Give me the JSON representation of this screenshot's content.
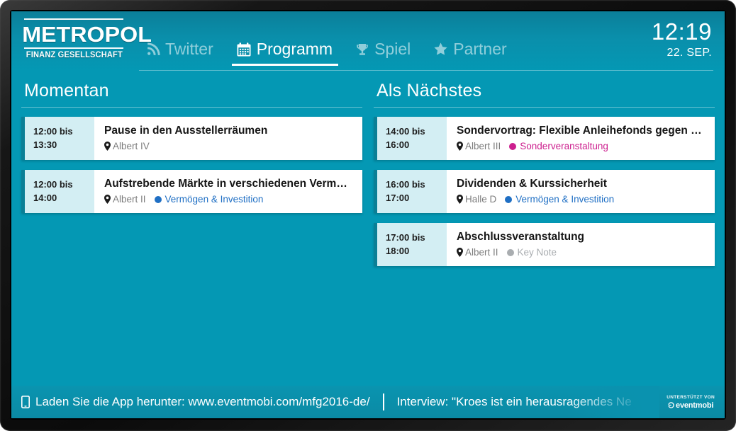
{
  "brand": {
    "logo_main": "METROPOL",
    "logo_sub": "FINANZ GESELLSCHAFT"
  },
  "header": {
    "nav": [
      {
        "label": "Twitter",
        "icon": "rss-icon",
        "active": false
      },
      {
        "label": "Programm",
        "icon": "calendar-icon",
        "active": true
      },
      {
        "label": "Spiel",
        "icon": "trophy-icon",
        "active": false
      },
      {
        "label": "Partner",
        "icon": "star-icon",
        "active": false
      }
    ],
    "clock": {
      "time": "12:19",
      "date": "22. SEP."
    }
  },
  "columns": [
    {
      "title": "Momentan",
      "sessions": [
        {
          "start": "12:00 bis",
          "end": "13:30",
          "title": "Pause in den Ausstellerräumen",
          "location": "Albert IV",
          "track": null,
          "track_color": null
        },
        {
          "start": "12:00 bis",
          "end": "14:00",
          "title": "Aufstrebende Märkte in verschiedenen Vermögens...",
          "location": "Albert II",
          "track": "Vermögen & Investition",
          "track_color": "#1f6fc4"
        }
      ]
    },
    {
      "title": "Als Nächstes",
      "sessions": [
        {
          "start": "14:00 bis",
          "end": "16:00",
          "title": "Sondervortrag: Flexible Anleihefonds gegen Kursve...",
          "location": "Albert III",
          "track": "Sonderveranstaltung",
          "track_color": "#cc1f8e"
        },
        {
          "start": "16:00 bis",
          "end": "17:00",
          "title": "Dividenden & Kurssicherheit",
          "location": "Halle D",
          "track": "Vermögen & Investition",
          "track_color": "#1f6fc4"
        },
        {
          "start": "17:00 bis",
          "end": "18:00",
          "title": "Abschlussveranstaltung",
          "location": "Albert II",
          "track": "Key Note",
          "track_color": "#a9adb0"
        }
      ]
    }
  ],
  "footer": {
    "ticker": [
      {
        "icon": "phone-icon",
        "text": "Laden Sie die App herunter: www.eventmobi.com/mfg2016-de/"
      },
      {
        "icon": null,
        "text": "Interview: \"Kroes ist ein herausragendes Ne"
      }
    ],
    "sponsor": {
      "label": "UNTERSTÜTZT VON",
      "name": "eventmobi"
    }
  },
  "theme": {
    "screen_bg": "#0498b4",
    "header_bg": "#0a8fab",
    "card_bg": "#ffffff",
    "card_accent": "#0b7f96",
    "time_bg": "#d3eef3"
  }
}
